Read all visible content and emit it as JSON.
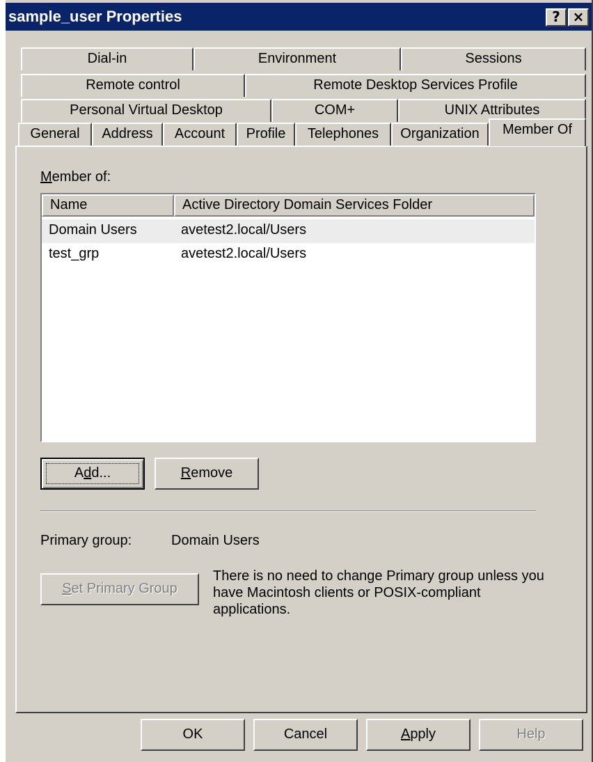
{
  "window": {
    "title": "sample_user Properties",
    "help_glyph": "?",
    "close_glyph": "×"
  },
  "tabs": {
    "row1": [
      "Dial-in",
      "Environment",
      "Sessions"
    ],
    "row2": [
      "Remote control",
      "Remote Desktop Services Profile"
    ],
    "row3": [
      "Personal Virtual Desktop",
      "COM+",
      "UNIX Attributes"
    ],
    "row4": [
      "General",
      "Address",
      "Account",
      "Profile",
      "Telephones",
      "Organization",
      "Member Of"
    ],
    "active": "Member Of"
  },
  "member_of": {
    "label_accel": "M",
    "label_rest": "ember of:",
    "columns": [
      "Name",
      "Active Directory Domain Services Folder"
    ],
    "rows": [
      {
        "name": "Domain Users",
        "folder": "avetest2.local/Users"
      },
      {
        "name": "test_grp",
        "folder": "avetest2.local/Users"
      }
    ],
    "add_pre": "A",
    "add_accel": "d",
    "add_post": "d...",
    "remove_accel": "R",
    "remove_rest": "emove"
  },
  "primary": {
    "label": "Primary group:",
    "value": "Domain Users",
    "set_accel": "S",
    "set_rest": "et Primary Group",
    "note": "There is no need to change Primary group unless you have Macintosh clients or POSIX-compliant applications."
  },
  "footer": {
    "ok": "OK",
    "cancel": "Cancel",
    "apply_accel": "A",
    "apply_rest": "pply",
    "help": "Help"
  },
  "colors": {
    "titlebar": "#0a246a",
    "face": "#d4d0c8",
    "alt_row": "#ececec"
  }
}
